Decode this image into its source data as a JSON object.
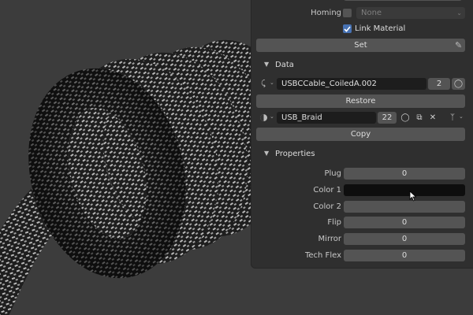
{
  "top": {
    "homing_label": "Homing",
    "homing_value": "None",
    "link_material_label": "Link Material",
    "set_label": "Set"
  },
  "data_section": {
    "title": "Data",
    "mesh_name": "USBCCable_CoiledA.002",
    "mesh_users": "2",
    "restore_label": "Restore",
    "material_name": "USB_Braid",
    "material_users": "22",
    "copy_label": "Copy"
  },
  "properties": {
    "title": "Properties",
    "fields": [
      {
        "label": "Plug",
        "value": "0"
      },
      {
        "label": "Color 1",
        "value": ""
      },
      {
        "label": "Color 2",
        "value": ""
      },
      {
        "label": "Flip",
        "value": "0"
      },
      {
        "label": "Mirror",
        "value": "0"
      },
      {
        "label": "Tech Flex",
        "value": "0"
      }
    ]
  },
  "colors": {
    "accent_check": "#4772b3",
    "color1": "#0e0e0e",
    "color2": "#545454"
  }
}
